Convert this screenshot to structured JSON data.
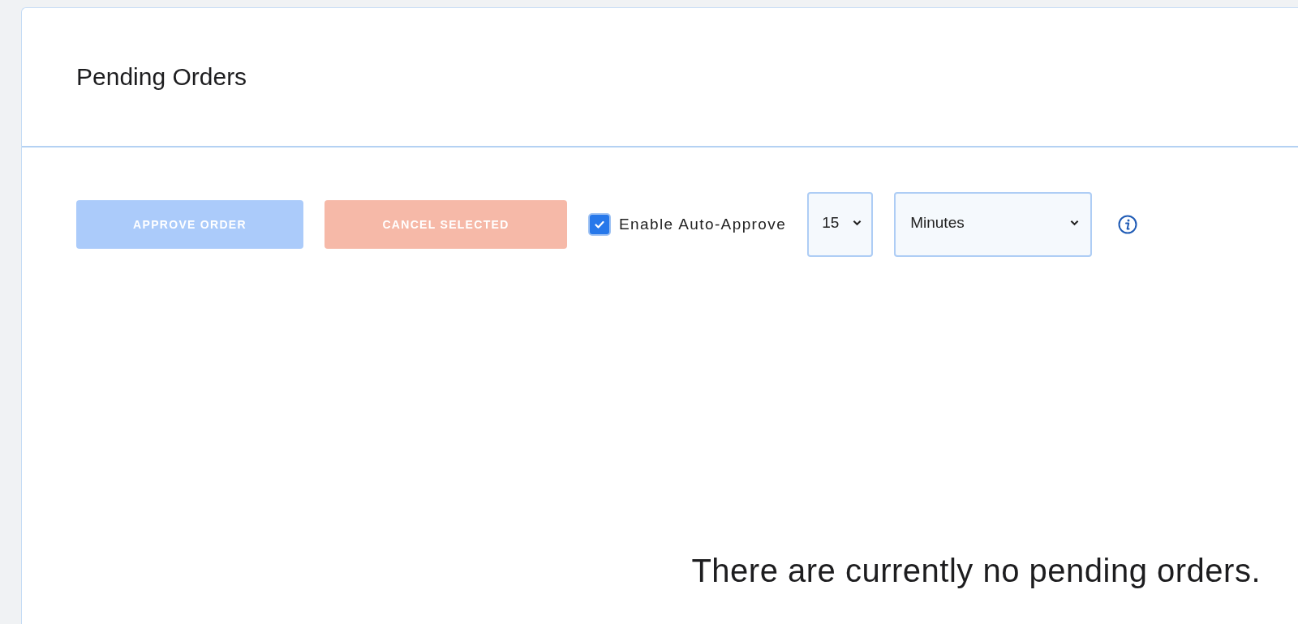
{
  "panel": {
    "title": "Pending Orders"
  },
  "toolbar": {
    "buttons": [
      {
        "label": "APPROVE ORDER",
        "kind": "primary",
        "disabled": true
      },
      {
        "label": "CANCEL SELECTED",
        "kind": "danger",
        "disabled": true
      }
    ],
    "auto_approve": {
      "label": "Enable Auto-Approve",
      "checked": true
    },
    "interval": {
      "value": "15"
    },
    "unit": {
      "value": "Minutes"
    }
  },
  "empty_message": "There are currently no pending orders."
}
